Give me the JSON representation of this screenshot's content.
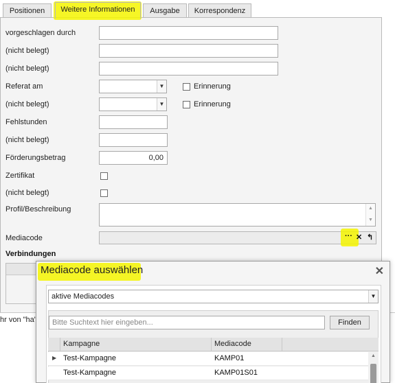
{
  "tabs": [
    {
      "label": "Positionen"
    },
    {
      "label": "Weitere Informationen"
    },
    {
      "label": "Ausgabe"
    },
    {
      "label": "Korrespondenz"
    }
  ],
  "form": {
    "vorgeschlagen": "vorgeschlagen durch",
    "nb1": "(nicht belegt)",
    "nb2": "(nicht belegt)",
    "referat": "Referat am",
    "nb3": "(nicht belegt)",
    "fehlstunden": "Fehlstunden",
    "nb4": "(nicht belegt)",
    "foerderung": "Förderungsbetrag",
    "foerderung_value": "0,00",
    "zertifikat": "Zertifikat",
    "nb5": "(nicht belegt)",
    "profil": "Profil/Beschreibung",
    "mediacode": "Mediacode",
    "erinnerung1": "Erinnerung",
    "erinnerung2": "Erinnerung"
  },
  "mediacode_buttons": {
    "more": "···",
    "clear": "✕",
    "undo": "↰"
  },
  "section": {
    "verbindungen": "Verbindungen"
  },
  "status": {
    "text": "hr von \"ha\""
  },
  "dialog": {
    "title": "Mediacode auswählen",
    "filter_value": "aktive Mediacodes",
    "search_placeholder": "Bitte Suchtext hier eingeben...",
    "find_label": "Finden",
    "columns": [
      "Kampagne",
      "Mediacode"
    ],
    "rows": [
      {
        "kampagne": "Test-Kampagne",
        "mediacode": "KAMP01"
      },
      {
        "kampagne": "Test-Kampagne",
        "mediacode": "KAMP01S01"
      }
    ]
  },
  "colors": {
    "highlight": "#f5f500",
    "panel": "#f4f4f4",
    "border": "#b9b9b9"
  },
  "icons": [
    "chevron-down-icon",
    "close-icon",
    "row-indicator-icon",
    "scroll-up-icon",
    "scroll-down-icon"
  ]
}
